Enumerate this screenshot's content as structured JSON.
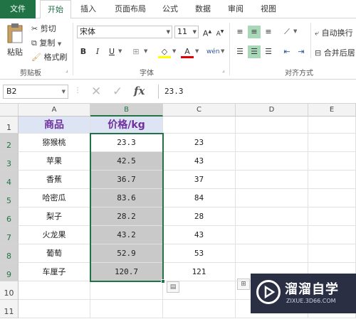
{
  "tabs": [
    "文件",
    "开始",
    "插入",
    "页面布局",
    "公式",
    "数据",
    "审阅",
    "视图"
  ],
  "clipboard": {
    "paste": "粘贴",
    "cut": "剪切",
    "copy": "复制",
    "format_painter": "格式刷",
    "group_label": "剪贴板"
  },
  "font": {
    "name": "宋体",
    "size": "11",
    "bold": "B",
    "italic": "I",
    "underline": "U",
    "group_label": "字体"
  },
  "alignment": {
    "wrap_text": "自动换行",
    "merge_center": "合并后居",
    "group_label": "对齐方式"
  },
  "formula_bar": {
    "name_box": "B2",
    "fx": "fx",
    "value": "23.3"
  },
  "columns": [
    "A",
    "B",
    "C",
    "D",
    "E"
  ],
  "rows": [
    "1",
    "2",
    "3",
    "4",
    "5",
    "6",
    "7",
    "8",
    "9",
    "10",
    "11"
  ],
  "sheet": {
    "header_a": "商品",
    "header_b": "价格/kg",
    "items": [
      {
        "name": "猕猴桃",
        "price": "23.3",
        "rounded": "23"
      },
      {
        "name": "苹果",
        "price": "42.5",
        "rounded": "43"
      },
      {
        "name": "香蕉",
        "price": "36.7",
        "rounded": "37"
      },
      {
        "name": "哈密瓜",
        "price": "83.6",
        "rounded": "84"
      },
      {
        "name": "梨子",
        "price": "28.2",
        "rounded": "28"
      },
      {
        "name": "火龙果",
        "price": "43.2",
        "rounded": "43"
      },
      {
        "name": "葡萄",
        "price": "52.9",
        "rounded": "53"
      },
      {
        "name": "车厘子",
        "price": "120.7",
        "rounded": "121"
      }
    ]
  },
  "watermark": {
    "title": "溜溜自学",
    "subtitle": "ZIXUE.3D66.COM"
  },
  "colors": {
    "accent": "#217346",
    "header_fill": "#dde4f3",
    "header_text": "#7030a0",
    "selection_fill": "#c9c9c9"
  }
}
